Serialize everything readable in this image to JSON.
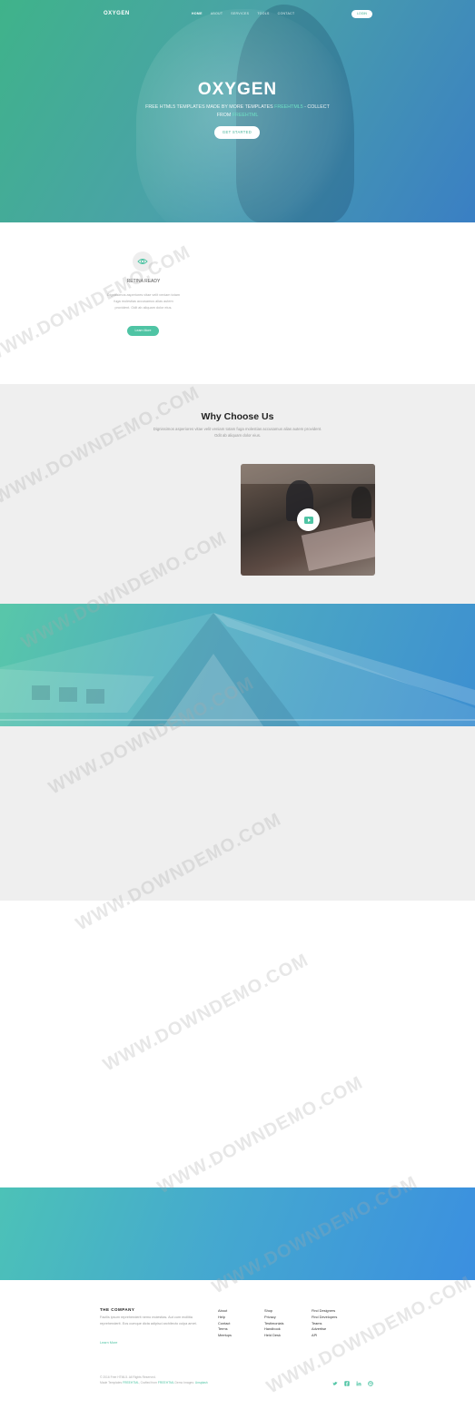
{
  "nav": {
    "brand": "OXYGEN",
    "links": [
      "HOME",
      "ABOUT",
      "SERVICES",
      "TOOLS",
      "CONTACT"
    ],
    "login_label": "LOGIN"
  },
  "hero": {
    "title": "OXYGEN",
    "subtitle_part1": "FREE HTML5 TEMPLATES MADE BY MORE TEMPLATES",
    "subtitle_highlight1": "FREEHTML5",
    "subtitle_part2": "- COLLECT FROM",
    "subtitle_highlight2": "FREEHTML",
    "button_label": "GET STARTED"
  },
  "feature": {
    "icon": "eye-icon",
    "title": "RETINA READY",
    "text": "Dignissimos asperiores vitae velit veniam totam fuga molestias accusamus alias autem provident. Odit ab aliquam dolor eius.",
    "button_label": "Learn More"
  },
  "why": {
    "title": "Why Choose Us",
    "text": "Dignissimos asperiores vitae velit veniam totam fuga molestias accusamus alias autem provident. Odit ab aliquam dolor eius.",
    "video_icon": "play-icon"
  },
  "footer": {
    "company_heading": "THE COMPANY",
    "company_text": "Facilis ipsum reprehenderit nemo molestias. Aut cum mollitia reprehenderit. Eos cumque dicta adipisci architecto culpa amet.",
    "company_link": "Learn More",
    "col1": [
      "About",
      "Help",
      "Contact",
      "Terms",
      "Meetups"
    ],
    "col2": [
      "Shop",
      "Privacy",
      "Testimonials",
      "Handbook",
      "Held Desk"
    ],
    "col3": [
      "Find Designers",
      "Find Developers",
      "Teams",
      "Advertise",
      "API"
    ],
    "copyright": "© 2016 Free HTML5. All Rights Reserved.",
    "credits_prefix": "Made Templates",
    "credits_h1": "FREEHTML",
    "credits_mid": ", Crafted from",
    "credits_h2": "FREEHTML",
    "credits_suffix": "Demo Images:",
    "credits_h3": "Unsplash",
    "social": [
      "twitter-icon",
      "facebook-icon",
      "linkedin-icon",
      "dribbble-icon"
    ]
  },
  "watermark": {
    "text": "WWW.DOWNDEMO.COM"
  },
  "colors": {
    "accent": "#4fc4a4",
    "hero_start": "#3fb38a",
    "hero_end": "#3a7fc4"
  }
}
